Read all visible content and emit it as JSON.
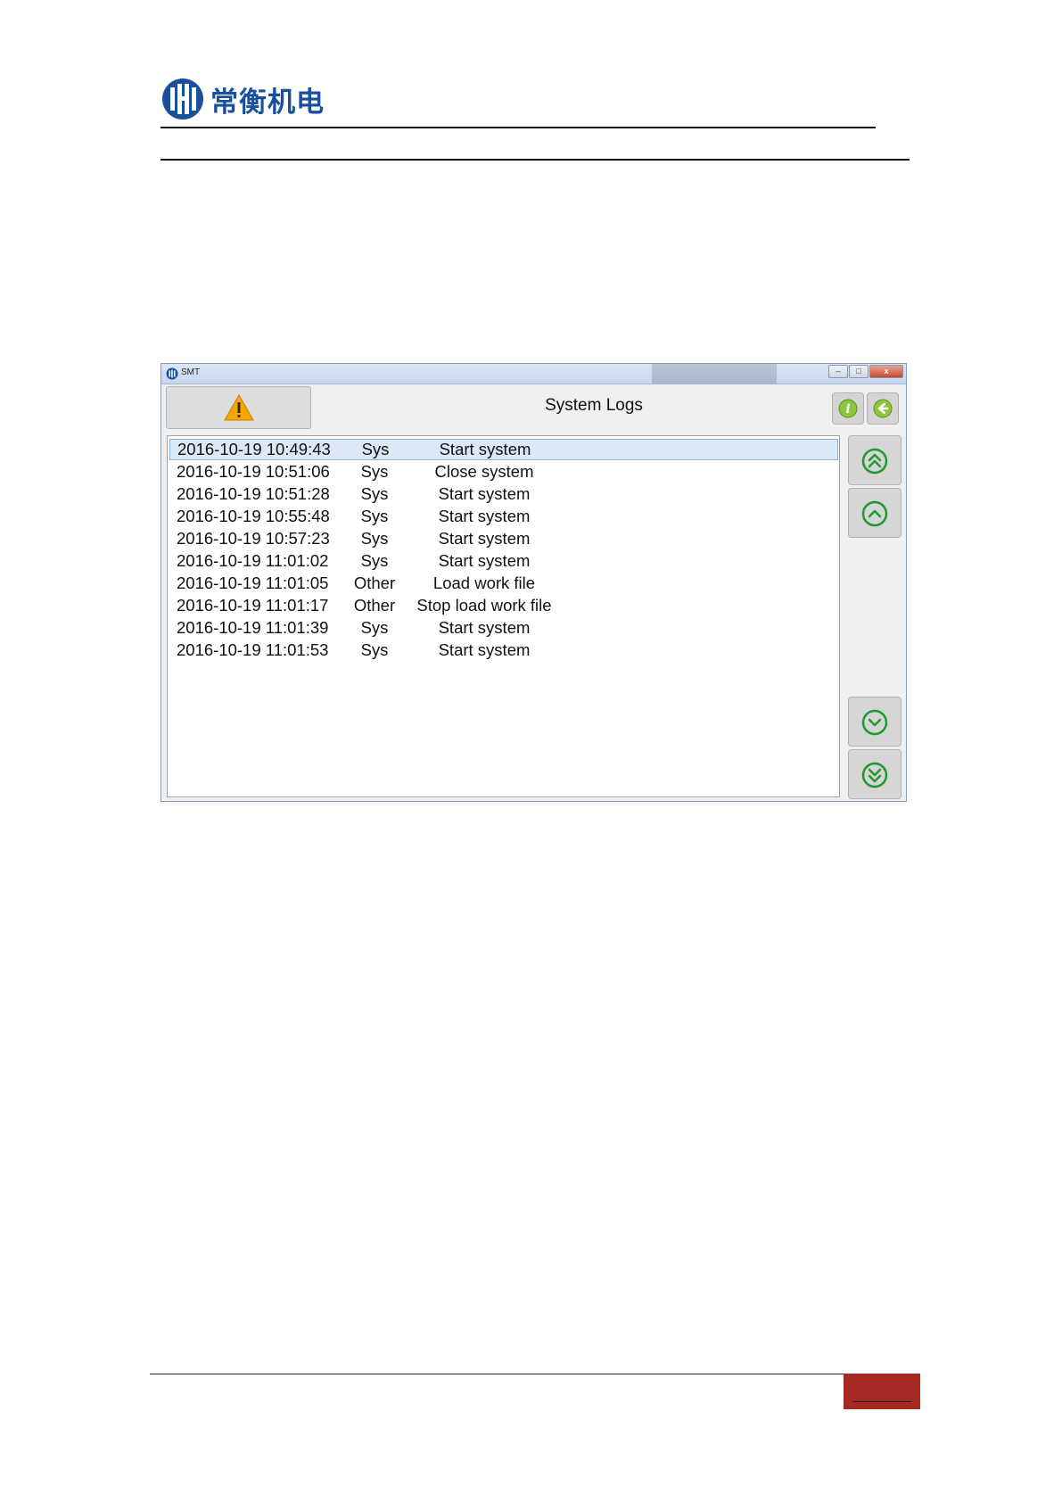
{
  "brand": {
    "name": "常衡机电",
    "color": "#1a4f9c"
  },
  "window": {
    "title": "SMT",
    "controls": {
      "minimize": "–",
      "maximize": "□",
      "close": "x"
    }
  },
  "header": {
    "title": "System Logs",
    "alarm_icon": "warning-triangle-icon",
    "buttons": [
      {
        "name": "info-button",
        "icon": "info-icon"
      },
      {
        "name": "back-button",
        "icon": "back-arrow-icon"
      }
    ]
  },
  "logs": [
    {
      "time": "2016-10-19 10:49:43",
      "type": "Sys",
      "message": "Start system"
    },
    {
      "time": "2016-10-19 10:51:06",
      "type": "Sys",
      "message": "Close system"
    },
    {
      "time": "2016-10-19 10:51:28",
      "type": "Sys",
      "message": "Start system"
    },
    {
      "time": "2016-10-19 10:55:48",
      "type": "Sys",
      "message": "Start system"
    },
    {
      "time": "2016-10-19 10:57:23",
      "type": "Sys",
      "message": "Start system"
    },
    {
      "time": "2016-10-19 11:01:02",
      "type": "Sys",
      "message": "Start system"
    },
    {
      "time": "2016-10-19 11:01:05",
      "type": "Other",
      "message": "Load work file"
    },
    {
      "time": "2016-10-19 11:01:17",
      "type": "Other",
      "message": "Stop load work file"
    },
    {
      "time": "2016-10-19 11:01:39",
      "type": "Sys",
      "message": "Start system"
    },
    {
      "time": "2016-10-19 11:01:53",
      "type": "Sys",
      "message": "Start system"
    }
  ],
  "selected_row": 0,
  "scroll_buttons": [
    {
      "name": "page-up-button",
      "icon": "double-chevron-up-icon"
    },
    {
      "name": "line-up-button",
      "icon": "chevron-up-icon"
    },
    {
      "name": "line-down-button",
      "icon": "chevron-down-icon"
    },
    {
      "name": "page-down-button",
      "icon": "double-chevron-down-icon"
    }
  ],
  "colors": {
    "accent_green": "#1f9a2e",
    "footer_badge": "#a52a24",
    "selection": "#dbe8f8"
  }
}
